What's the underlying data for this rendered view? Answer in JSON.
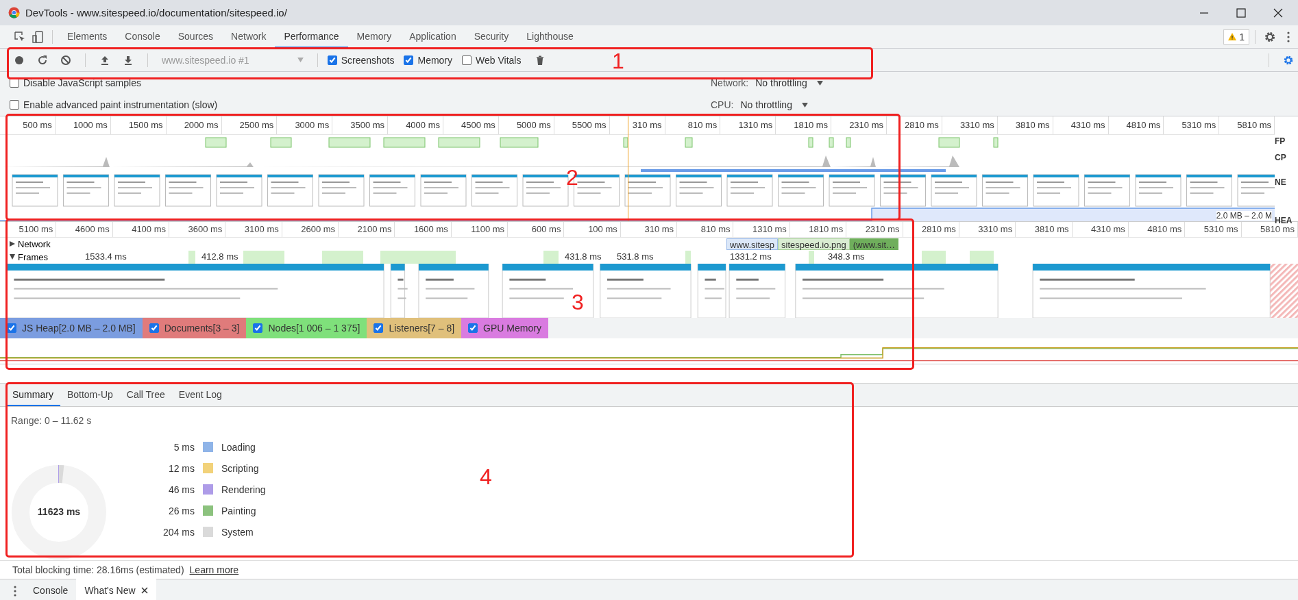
{
  "window": {
    "title": "DevTools - www.sitespeed.io/documentation/sitespeed.io/"
  },
  "tabs": [
    {
      "label": "Elements",
      "selected": false
    },
    {
      "label": "Console",
      "selected": false
    },
    {
      "label": "Sources",
      "selected": false
    },
    {
      "label": "Network",
      "selected": false
    },
    {
      "label": "Performance",
      "selected": true
    },
    {
      "label": "Memory",
      "selected": false
    },
    {
      "label": "Application",
      "selected": false
    },
    {
      "label": "Security",
      "selected": false
    },
    {
      "label": "Lighthouse",
      "selected": false
    }
  ],
  "warning_badge": "1",
  "toolbar": {
    "recording": "www.sitespeed.io #1",
    "checkboxes": [
      {
        "label": "Screenshots",
        "checked": true
      },
      {
        "label": "Memory",
        "checked": true
      },
      {
        "label": "Web Vitals",
        "checked": false
      }
    ]
  },
  "settings": {
    "checkboxes": [
      {
        "label": "Disable JavaScript samples",
        "checked": false
      },
      {
        "label": "Enable advanced paint instrumentation (slow)",
        "checked": false
      }
    ],
    "network": {
      "label": "Network:",
      "value": "No throttling"
    },
    "cpu": {
      "label": "CPU:",
      "value": "No throttling"
    }
  },
  "overview": {
    "ticks": [
      "500 ms",
      "1000 ms",
      "1500 ms",
      "2000 ms",
      "2500 ms",
      "3000 ms",
      "3500 ms",
      "4000 ms",
      "4500 ms",
      "5000 ms",
      "5500 ms",
      "310 ms",
      "810 ms",
      "1310 ms",
      "1810 ms",
      "2310 ms",
      "2810 ms",
      "3310 ms",
      "3810 ms",
      "4310 ms",
      "4810 ms",
      "5310 ms",
      "5810 ms"
    ],
    "track_labels": [
      "FP",
      "CP",
      "NE",
      "HEA"
    ],
    "heap_reading": "2.0 MB – 2.0 M"
  },
  "timeline": {
    "ticks": [
      "5100 ms",
      "4600 ms",
      "4100 ms",
      "3600 ms",
      "3100 ms",
      "2600 ms",
      "2100 ms",
      "1600 ms",
      "1100 ms",
      "600 ms",
      "100 ms",
      "310 ms",
      "810 ms",
      "1310 ms",
      "1810 ms",
      "2310 ms",
      "2810 ms",
      "3310 ms",
      "3810 ms",
      "4310 ms",
      "4810 ms",
      "5310 ms",
      "5810 ms"
    ],
    "tracks": [
      {
        "label": "Network",
        "expanded": false
      },
      {
        "label": "Frames",
        "expanded": true
      }
    ],
    "network_requests": [
      "www.sitesp",
      "sitespeed.io.png",
      "(www.sit…"
    ],
    "frame_durations": [
      "1533.4 ms",
      "412.8 ms",
      "431.8 ms",
      "531.8 ms",
      "1331.2 ms",
      "348.3 ms"
    ]
  },
  "counters": [
    {
      "label": "JS Heap[2.0 MB – 2.0 MB]",
      "checked": true,
      "color": "#7b9de0"
    },
    {
      "label": "Documents[3 – 3]",
      "checked": true,
      "color": "#e07b7b"
    },
    {
      "label": "Nodes[1 006 – 1 375]",
      "checked": true,
      "color": "#7fe07b"
    },
    {
      "label": "Listeners[7 – 8]",
      "checked": true,
      "color": "#e0c07b"
    },
    {
      "label": "GPU Memory",
      "checked": true,
      "color": "#d97be0"
    }
  ],
  "summary_tabs": [
    {
      "label": "Summary",
      "selected": true
    },
    {
      "label": "Bottom-Up",
      "selected": false
    },
    {
      "label": "Call Tree",
      "selected": false
    },
    {
      "label": "Event Log",
      "selected": false
    }
  ],
  "summary": {
    "range": "Range: 0 – 11.62 s",
    "total": "11623 ms",
    "categories": [
      {
        "time": "5 ms",
        "name": "Loading",
        "color": "#8fb4e8"
      },
      {
        "time": "12 ms",
        "name": "Scripting",
        "color": "#f2d27a"
      },
      {
        "time": "46 ms",
        "name": "Rendering",
        "color": "#ae9ce8"
      },
      {
        "time": "26 ms",
        "name": "Painting",
        "color": "#8cc27e"
      },
      {
        "time": "204 ms",
        "name": "System",
        "color": "#dadada"
      }
    ]
  },
  "footer": {
    "text": "Total blocking time: 28.16ms (estimated)",
    "link": "Learn more"
  },
  "drawer_tabs": [
    {
      "label": "Console",
      "selected": false,
      "closable": false
    },
    {
      "label": "What's New",
      "selected": true,
      "closable": true
    }
  ],
  "annotations": [
    {
      "label": "1"
    },
    {
      "label": "2"
    },
    {
      "label": "3"
    },
    {
      "label": "4"
    }
  ]
}
